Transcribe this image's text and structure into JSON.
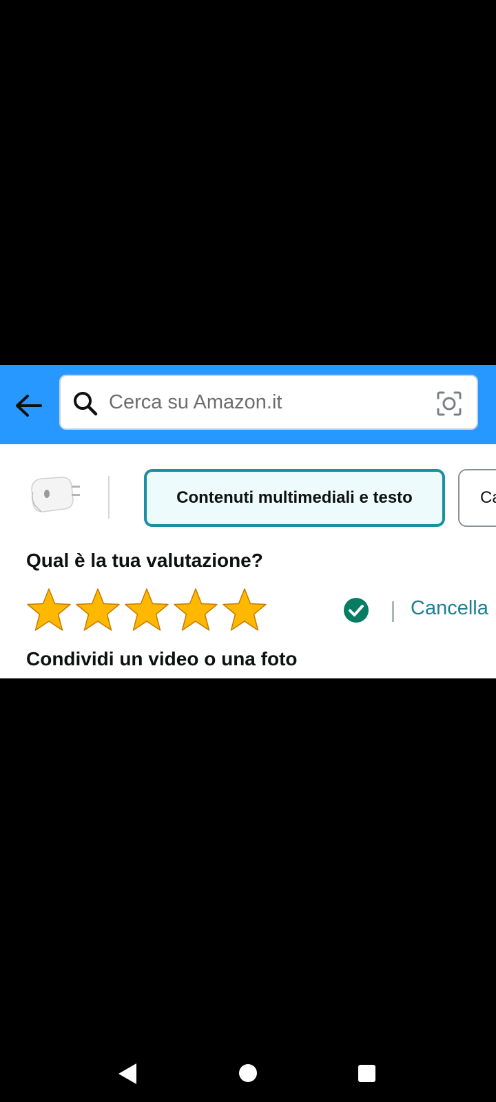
{
  "header": {
    "background_color": "#2798ff",
    "back_icon": "arrow-left-icon",
    "search": {
      "placeholder": "Cerca su Amazon.it",
      "value": "",
      "search_icon": "search-icon",
      "camera_icon": "camera-icon"
    }
  },
  "review": {
    "product_image": "white-usb-c-charger",
    "tabs": [
      {
        "label": "Contenuti multimediali e testo",
        "selected": true
      },
      {
        "label": "Ca",
        "selected": false
      }
    ],
    "rating_question": "Qual è la tua valutazione?",
    "rating": {
      "value": 5,
      "max": 5
    },
    "status_icon": "check-circle-icon",
    "cancel_label": "Cancella",
    "share_heading": "Condividi un video o una foto",
    "accent_color": "#1b8fa3",
    "star_color": "#ffb800",
    "check_color": "#067d62"
  },
  "system_nav": {
    "back_icon": "triangle-back-icon",
    "home_icon": "circle-home-icon",
    "recents_icon": "square-recents-icon"
  }
}
